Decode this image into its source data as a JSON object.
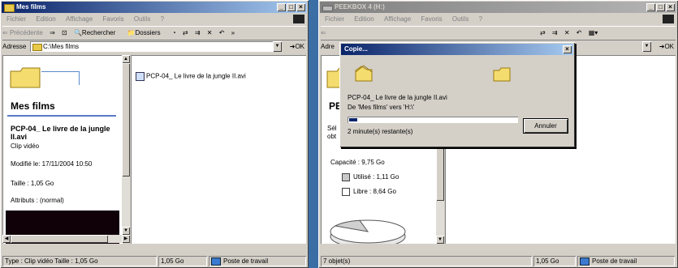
{
  "left_window": {
    "title": "Mes films",
    "menu": [
      "Fichier",
      "Edition",
      "Affichage",
      "Favoris",
      "Outils",
      "?"
    ],
    "toolbar": {
      "back": "⇐ Précédente",
      "forward": "⇒",
      "up": "⊡",
      "search": "Rechercher",
      "folders": "Dossiers",
      "more": "»"
    },
    "address_label": "Adresse",
    "address_value": "C:\\Mes films",
    "ok_label": "OK",
    "panel_title": "Mes films",
    "file_title": "PCP-04_ Le livre de la jungle II.avi",
    "file_type": "Clip vidéo",
    "modified": "Modifié le: 17/11/2004 10:50",
    "size": "Taille : 1,05 Go",
    "attributes": "Attributs : (normal)",
    "list_item": "PCP-04_ Le livre de la jungle II.avi",
    "status_left": "Type : Clip vidéo Taille : 1,05 Go",
    "status_mid": "1,05 Go",
    "status_right": "Poste de travail"
  },
  "right_window": {
    "title": "PEEKBOX 4 (H:)",
    "menu": [
      "Fichier",
      "Edition",
      "Affichage",
      "Favoris",
      "Outils",
      "?"
    ],
    "address_label": "Adre",
    "ok_label": "OK",
    "panel_title": "PE",
    "select_partial": "Sél",
    "obt_partial": "obt",
    "capacity": "Capacité : 9,75 Go",
    "used": "Utilisé : 1,11 Go",
    "free": "Libre : 8,64 Go",
    "status_left": "7 objet(s)",
    "status_mid": "1,05 Go",
    "status_right": "Poste de travail"
  },
  "copy_dialog": {
    "title": "Copie...",
    "file": "PCP-04_ Le livre de la jungle II.avi",
    "from_to": "De 'Mes films' vers 'H:\\'",
    "remaining": "2 minute(s) restante(s)",
    "progress": 0.05,
    "cancel": "Annuler"
  }
}
